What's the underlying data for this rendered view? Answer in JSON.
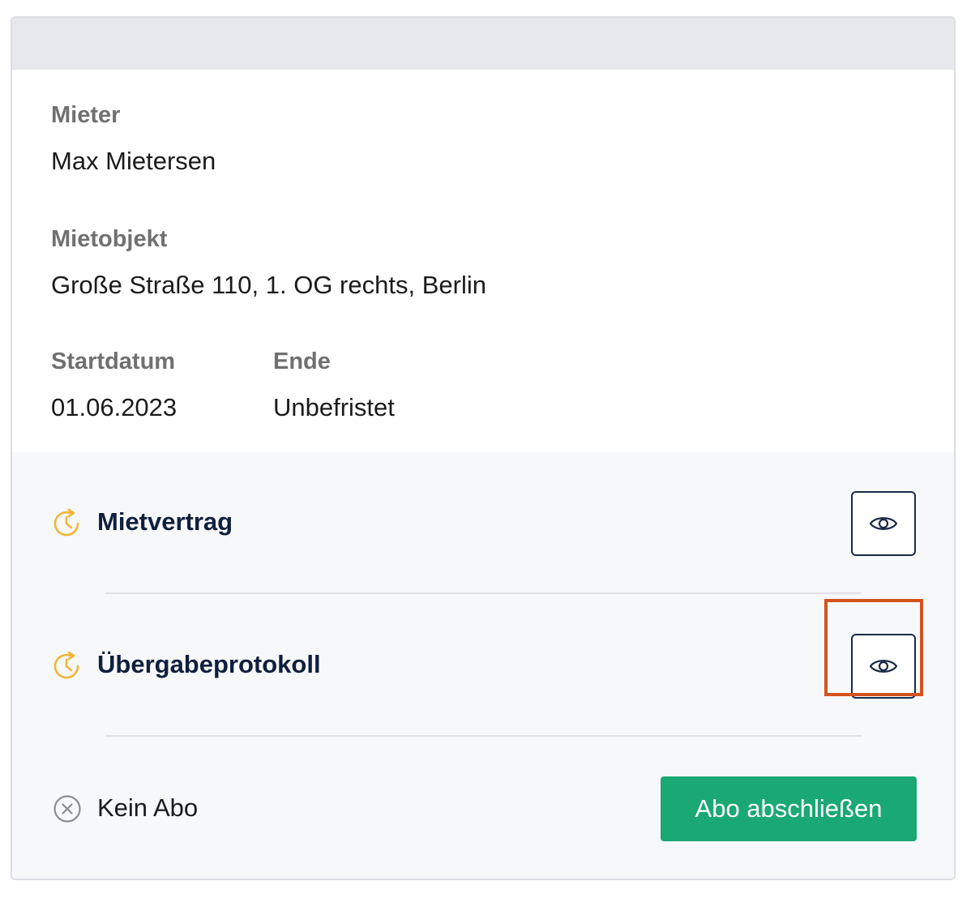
{
  "tenant": {
    "label": "Mieter",
    "value": "Max Mietersen"
  },
  "property": {
    "label": "Mietobjekt",
    "value": "Große Straße 110, 1. OG rechts, Berlin"
  },
  "start": {
    "label": "Startdatum",
    "value": "01.06.2023"
  },
  "end": {
    "label": "Ende",
    "value": "Unbefristet"
  },
  "documents": [
    {
      "title": "Mietvertrag",
      "status_icon": "clock-pending-icon",
      "action_icon": "eye-icon"
    },
    {
      "title": "Übergabeprotokoll",
      "status_icon": "clock-pending-icon",
      "action_icon": "eye-icon"
    }
  ],
  "subscription": {
    "status": "Kein Abo",
    "status_icon": "x-circle-icon",
    "button_label": "Abo abschließen"
  },
  "colors": {
    "accent": "#1aa873",
    "pending": "#f0b63a",
    "highlight": "#d4531d",
    "title": "#0f1f3d"
  }
}
